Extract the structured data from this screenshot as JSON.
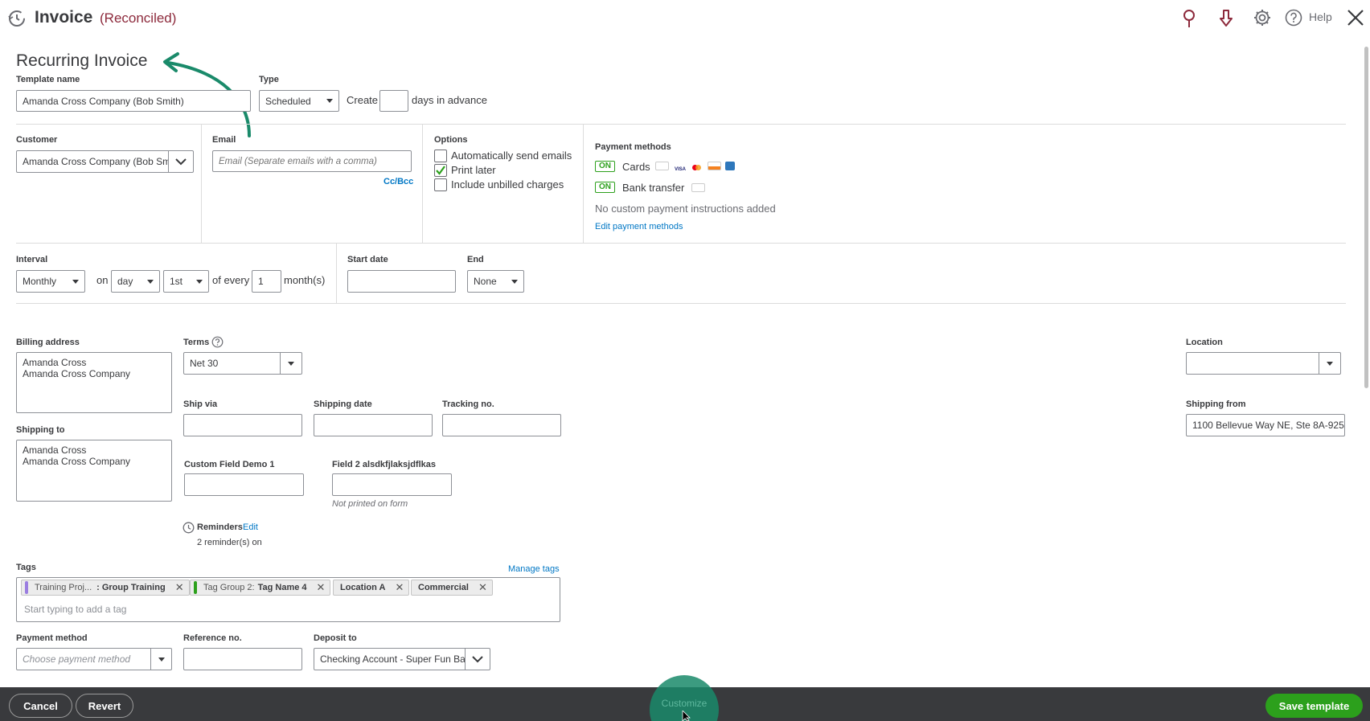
{
  "header": {
    "title": "Invoice",
    "status": "(Reconciled)",
    "help": "Help"
  },
  "page": {
    "heading": "Recurring Invoice"
  },
  "template": {
    "name_label": "Template name",
    "name_value": "Amanda Cross Company (Bob Smith)",
    "type_label": "Type",
    "type_value": "Scheduled",
    "create_label": "Create",
    "create_value": "",
    "days_label": "days in advance"
  },
  "customer": {
    "label": "Customer",
    "value": "Amanda Cross Company (Bob Sm"
  },
  "email": {
    "label": "Email",
    "placeholder": "Email (Separate emails with a comma)",
    "ccbcc": "Cc/Bcc"
  },
  "options": {
    "label": "Options",
    "items": [
      {
        "label": "Automatically send emails",
        "checked": false
      },
      {
        "label": "Print later",
        "checked": true
      },
      {
        "label": "Include unbilled charges",
        "checked": false
      }
    ]
  },
  "payment_methods": {
    "label": "Payment methods",
    "cards_toggle": "ON",
    "cards_label": "Cards",
    "bank_toggle": "ON",
    "bank_label": "Bank transfer",
    "note": "No custom payment instructions added",
    "edit_link": "Edit payment methods"
  },
  "interval": {
    "label": "Interval",
    "value": "Monthly",
    "on_label": "on",
    "day_value": "day",
    "ordinal_value": "1st",
    "of_every_label": "of every",
    "every_value": "1",
    "months_label": "month(s)",
    "start_label": "Start date",
    "start_value": "",
    "end_label": "End",
    "end_value": "None"
  },
  "billing": {
    "label": "Billing address",
    "lines": "Amanda Cross\nAmanda Cross Company"
  },
  "shipping_to": {
    "label": "Shipping to",
    "lines": "Amanda Cross\nAmanda Cross Company"
  },
  "terms": {
    "label": "Terms",
    "value": "Net 30"
  },
  "location": {
    "label": "Location",
    "value": ""
  },
  "ship_via": {
    "label": "Ship via"
  },
  "shipping_date": {
    "label": "Shipping date"
  },
  "tracking": {
    "label": "Tracking no."
  },
  "shipping_from": {
    "label": "Shipping from",
    "value": "1100 Bellevue Way NE, Ste 8A-925"
  },
  "custom_field_1": {
    "label": "Custom Field Demo 1"
  },
  "custom_field_2": {
    "label": "Field 2 alsdkfjlaksjdflkas",
    "note": "Not printed on form"
  },
  "reminders": {
    "label": "Reminders",
    "edit": "Edit",
    "status": "2 reminder(s) on"
  },
  "tags": {
    "label": "Tags",
    "manage": "Manage tags",
    "placeholder": "Start typing to add a tag",
    "items": [
      {
        "group": "Training Proj...",
        "name": ": Group Training",
        "color": "#9b7ee0"
      },
      {
        "group": "Tag Group 2:",
        "name": "Tag Name 4",
        "color": "#2ca01c"
      },
      {
        "group": "",
        "name": "Location A",
        "color": ""
      },
      {
        "group": "",
        "name": "Commercial",
        "color": ""
      }
    ]
  },
  "payment_method": {
    "label": "Payment method",
    "placeholder": "Choose payment method"
  },
  "reference": {
    "label": "Reference no."
  },
  "deposit": {
    "label": "Deposit to",
    "value": "Checking Account - Super Fun Ba"
  },
  "footer": {
    "cancel": "Cancel",
    "revert": "Revert",
    "customize": "Customize",
    "save": "Save template"
  },
  "colors": {
    "brand_green": "#2ca01c",
    "link": "#0077c5",
    "footer": "#393a3d",
    "header_accent": "#8d2a3c",
    "arrow": "#1a8a6a"
  }
}
